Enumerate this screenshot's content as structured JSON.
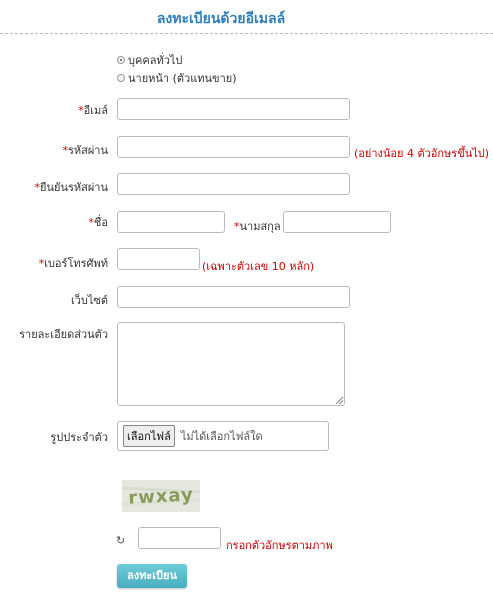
{
  "page_title": "ลงทะเบียนด้วยอีเมลล์",
  "account_type": {
    "options": [
      "บุคคลทั่วไป",
      "นายหน้า (ตัวแทนขาย)"
    ],
    "selected_index": 0
  },
  "fields": {
    "required_mark": "*",
    "email": {
      "label": "อีเมล์",
      "value": ""
    },
    "password": {
      "label": "รหัสผ่าน",
      "hint": "(อย่างน้อย 4 ตัวอักษรขึ้นไป)",
      "value": ""
    },
    "confirm_password": {
      "label": "ยืนยันรหัสผ่าน",
      "value": ""
    },
    "first_name": {
      "label": "ชื่อ",
      "value": ""
    },
    "last_name": {
      "label": "นามสกุล",
      "value": ""
    },
    "phone": {
      "label": "เบอร์โทรศัพท์",
      "hint": "(เฉพาะตัวเลข 10 หลัก)",
      "value": ""
    },
    "website": {
      "label": "เว็บไซต์",
      "value": ""
    },
    "details": {
      "label": "รายละเอียดส่วนตัว",
      "value": ""
    },
    "avatar": {
      "label": "รูปประจำตัว",
      "button": "เลือกไฟล์",
      "status": "ไม่ได้เลือกไฟล์ใด"
    }
  },
  "captcha": {
    "image_text": "rwxay",
    "refresh_icon": "refresh-icon",
    "refresh_glyph": "↻",
    "hint": "กรอกตัวอักษรตามภาพ",
    "value": ""
  },
  "submit_label": "ลงทะเบียน",
  "colors": {
    "title": "#2e7fb8",
    "required": "#cc0000",
    "button": "#47aebe"
  }
}
